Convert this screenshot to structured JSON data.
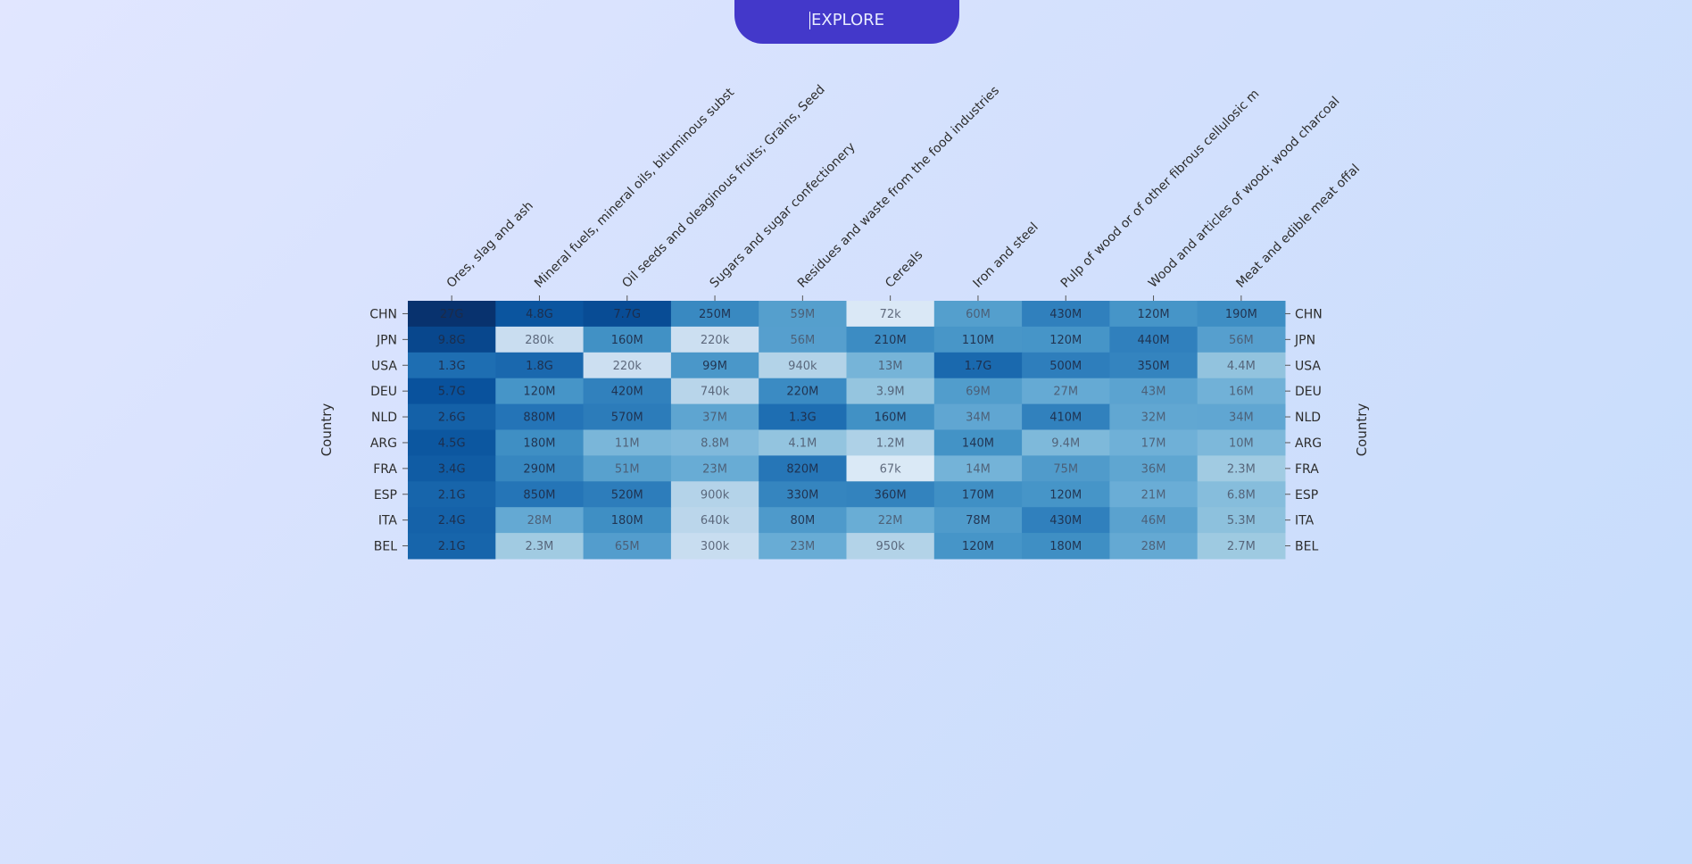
{
  "button": {
    "label": "EXPLORE"
  },
  "chart_data": {
    "type": "heatmap",
    "title": "",
    "xlabel": "",
    "ylabel": "Country",
    "ylabel_right": "Country",
    "colormap": "Blues",
    "categories": [
      "Ores, slag and ash",
      "Mineral fuels, mineral oils, bituminous subst",
      "Oil seeds and oleaginous fruits; Grains, Seed",
      "Sugars and sugar confectionery",
      "Residues and waste from the food industries",
      "Cereals",
      "Iron and steel",
      "Pulp of wood or of other fibrous cellulosic m",
      "Wood and articles of wood; wood charcoal",
      "Meat and edible meat offal"
    ],
    "rows": [
      "CHN",
      "JPN",
      "USA",
      "DEU",
      "NLD",
      "ARG",
      "FRA",
      "ESP",
      "ITA",
      "BEL"
    ],
    "values": [
      [
        27000000000,
        4800000000,
        7700000000,
        250000000,
        59000000,
        72000,
        60000000,
        430000000,
        120000000,
        190000000
      ],
      [
        9800000000,
        280000,
        160000000,
        220000,
        56000000,
        210000000,
        110000000,
        120000000,
        440000000,
        56000000
      ],
      [
        1300000000,
        1800000000,
        220000,
        99000000,
        940000,
        13000000,
        1700000000,
        500000000,
        350000000,
        4400000
      ],
      [
        5700000000,
        120000000,
        420000000,
        740000,
        220000000,
        3900000,
        69000000,
        27000000,
        43000000,
        16000000
      ],
      [
        2600000000,
        880000000,
        570000000,
        37000000,
        1300000000,
        160000000,
        34000000,
        410000000,
        32000000,
        34000000
      ],
      [
        4500000000,
        180000000,
        11000000,
        8800000,
        4100000,
        1200000,
        140000000,
        9400000,
        17000000,
        10000000
      ],
      [
        3400000000,
        290000000,
        51000000,
        23000000,
        820000000,
        67000,
        14000000,
        75000000,
        36000000,
        2300000
      ],
      [
        2100000000,
        850000000,
        520000000,
        900000,
        330000000,
        360000000,
        170000000,
        120000000,
        21000000,
        6800000
      ],
      [
        2400000000,
        28000000,
        180000000,
        640000,
        80000000,
        22000000,
        78000000,
        430000000,
        46000000,
        5300000
      ],
      [
        2100000000,
        2300000,
        65000000,
        300000,
        23000000,
        950000,
        120000000,
        180000000,
        28000000,
        2700000
      ]
    ],
    "labels": [
      [
        "27G",
        "4.8G",
        "7.7G",
        "250M",
        "59M",
        "72k",
        "60M",
        "430M",
        "120M",
        "190M"
      ],
      [
        "9.8G",
        "280k",
        "160M",
        "220k",
        "56M",
        "210M",
        "110M",
        "120M",
        "440M",
        "56M"
      ],
      [
        "1.3G",
        "1.8G",
        "220k",
        "99M",
        "940k",
        "13M",
        "1.7G",
        "500M",
        "350M",
        "4.4M"
      ],
      [
        "5.7G",
        "120M",
        "420M",
        "740k",
        "220M",
        "3.9M",
        "69M",
        "27M",
        "43M",
        "16M"
      ],
      [
        "2.6G",
        "880M",
        "570M",
        "37M",
        "1.3G",
        "160M",
        "34M",
        "410M",
        "32M",
        "34M"
      ],
      [
        "4.5G",
        "180M",
        "11M",
        "8.8M",
        "4.1M",
        "1.2M",
        "140M",
        "9.4M",
        "17M",
        "10M"
      ],
      [
        "3.4G",
        "290M",
        "51M",
        "23M",
        "820M",
        "67k",
        "14M",
        "75M",
        "36M",
        "2.3M"
      ],
      [
        "2.1G",
        "850M",
        "520M",
        "900k",
        "330M",
        "360M",
        "170M",
        "120M",
        "21M",
        "6.8M"
      ],
      [
        "2.4G",
        "28M",
        "180M",
        "640k",
        "80M",
        "22M",
        "78M",
        "430M",
        "46M",
        "5.3M"
      ],
      [
        "2.1G",
        "2.3M",
        "65M",
        "300k",
        "23M",
        "950k",
        "120M",
        "180M",
        "28M",
        "2.7M"
      ]
    ],
    "scale": "log",
    "color_range": [
      50000,
      30000000000
    ],
    "colors": {
      "low": "#deebf7",
      "high": "#08306b"
    },
    "legend": "none",
    "grid": false
  }
}
